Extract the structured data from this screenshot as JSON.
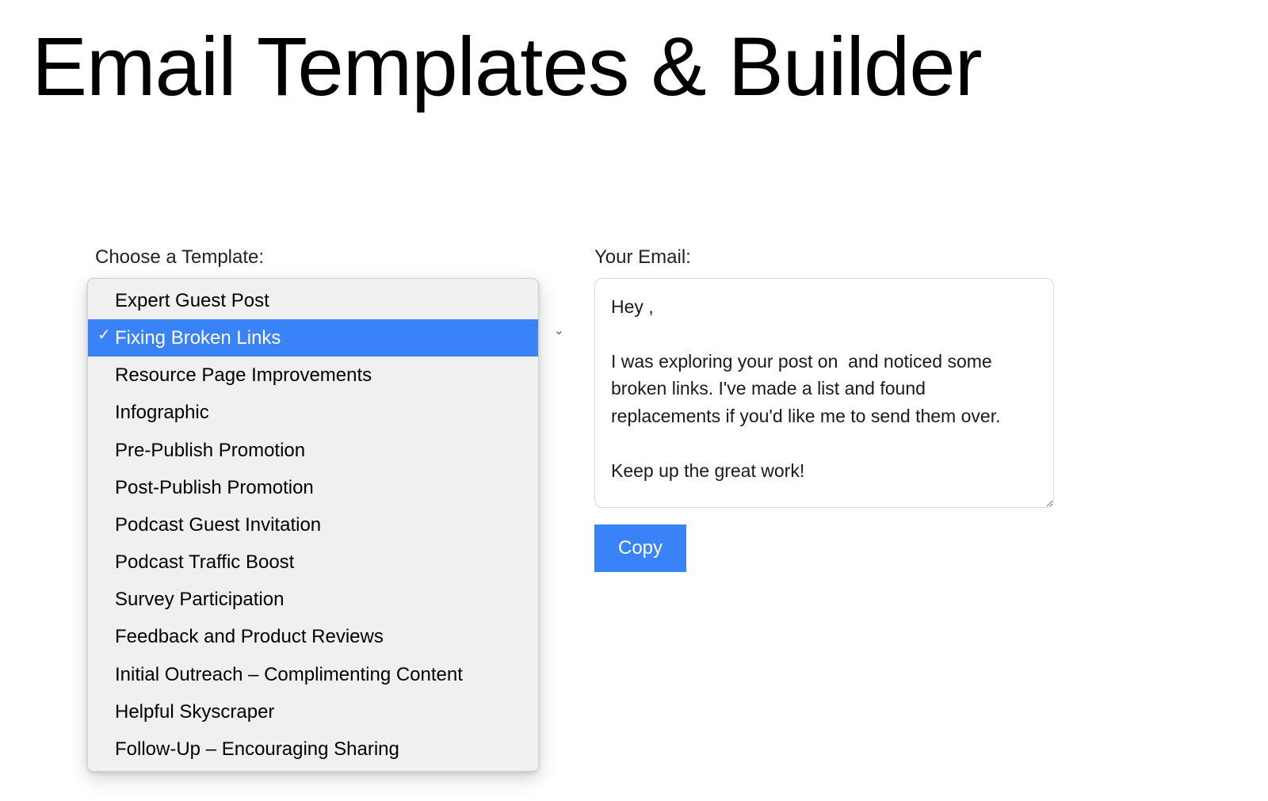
{
  "page": {
    "title": "Email Templates & Builder"
  },
  "left": {
    "label": "Choose a Template:",
    "selected_index": 1,
    "options": [
      "Expert Guest Post",
      "Fixing Broken Links",
      "Resource Page Improvements",
      "Infographic",
      "Pre-Publish Promotion",
      "Post-Publish Promotion",
      "Podcast Guest Invitation",
      "Podcast Traffic Boost",
      "Survey Participation",
      "Feedback and Product Reviews",
      "Initial Outreach – Complimenting Content",
      "Helpful Skyscraper",
      "Follow-Up – Encouraging Sharing"
    ]
  },
  "right": {
    "label": "Your Email:",
    "email_body": "Hey ,\n\nI was exploring your post on  and noticed some broken links. I've made a list and found replacements if you'd like me to send them over.\n\nKeep up the great work!",
    "copy_label": "Copy"
  },
  "colors": {
    "accent": "#3a82f7"
  }
}
